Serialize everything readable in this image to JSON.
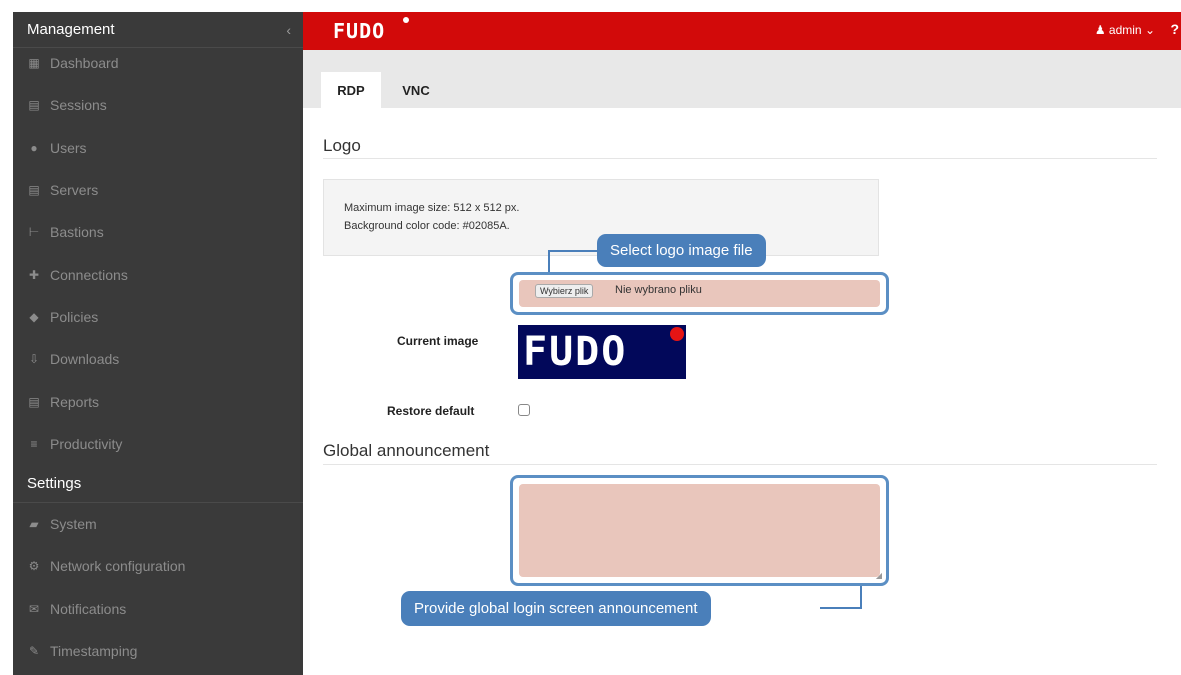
{
  "sidebar": {
    "management_title": "Management",
    "collapse_icon": "chevron-left-icon",
    "management_items": [
      {
        "label": "Dashboard",
        "icon": "bar-chart-icon"
      },
      {
        "label": "Sessions",
        "icon": "film-icon"
      },
      {
        "label": "Users",
        "icon": "users-icon"
      },
      {
        "label": "Servers",
        "icon": "server-icon"
      },
      {
        "label": "Bastions",
        "icon": "bastion-icon"
      },
      {
        "label": "Connections",
        "icon": "connections-icon"
      },
      {
        "label": "Policies",
        "icon": "shield-icon"
      },
      {
        "label": "Downloads",
        "icon": "download-icon"
      },
      {
        "label": "Reports",
        "icon": "print-icon"
      },
      {
        "label": "Productivity",
        "icon": "list-icon"
      }
    ],
    "settings_title": "Settings",
    "settings_items": [
      {
        "label": "System",
        "icon": "folder-open-icon"
      },
      {
        "label": "Network configuration",
        "icon": "cogs-icon"
      },
      {
        "label": "Notifications",
        "icon": "envelope-icon"
      },
      {
        "label": "Timestamping",
        "icon": "edit-icon"
      }
    ]
  },
  "header": {
    "brand": "FUDO",
    "user_label": "admin",
    "help": "?",
    "bg_color": "#d20a0a"
  },
  "tabs": [
    {
      "label": "RDP",
      "active": true
    },
    {
      "label": "VNC",
      "active": false
    }
  ],
  "logo_section": {
    "title": "Logo",
    "info_line1": "Maximum image size: 512 x 512 px.",
    "info_line2": "Background color code: #02085A.",
    "file_button": "Wybierz plik",
    "file_status": "Nie wybrano pliku",
    "current_image_label": "Current image",
    "current_image_text": "FUDO",
    "restore_default_label": "Restore default",
    "restore_default_checked": false,
    "logo_bg_color": "#02085A"
  },
  "announcement_section": {
    "title": "Global announcement",
    "value": ""
  },
  "callouts": {
    "select_logo": "Select logo image file",
    "provide_announcement": "Provide global login screen announcement",
    "color": "#4a7fba"
  }
}
